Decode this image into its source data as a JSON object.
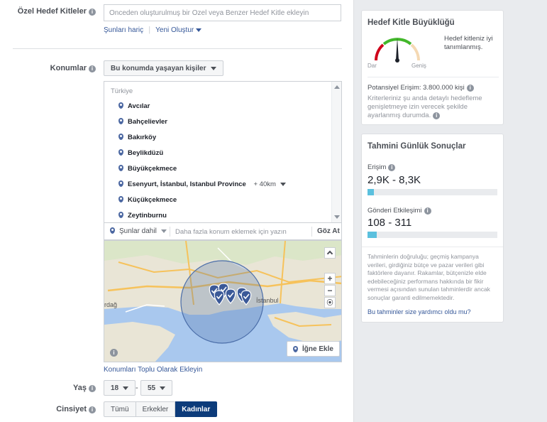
{
  "custom_audiences": {
    "label": "Özel Hedef Kitleler",
    "placeholder": "Onceden oluşturulmuş bir Ozel veya Benzer Hedef Kitle ekleyin",
    "exclude_link": "Şunları hariç",
    "create_link": "Yeni Oluştur"
  },
  "locations": {
    "label": "Konumlar",
    "type_dropdown": "Bu konumda yaşayan kişiler",
    "country": "Türkiye",
    "items": [
      {
        "name": "Avcılar"
      },
      {
        "name": "Bahçelievler"
      },
      {
        "name": "Bakırköy"
      },
      {
        "name": "Beylikdüzü"
      },
      {
        "name": "Büyükçekmece"
      },
      {
        "name": "Esenyurt, İstanbul, Istanbul Province",
        "radius": "+ 40km"
      },
      {
        "name": "Küçükçekmece"
      },
      {
        "name": "Zeytinburnu"
      }
    ],
    "include_dropdown": "Şunlar dahil",
    "search_placeholder": "Daha fazla konum eklemek için yazın",
    "browse_label": "Göz At",
    "add_pin_label": "İğne Ekle",
    "bulk_link": "Konumları Toplu Olarak Ekleyin",
    "map": {
      "city_label": "İstanbul",
      "left_label": "rdağ",
      "zoom_in": "+",
      "zoom_out": "−",
      "pins": 6
    }
  },
  "age": {
    "label": "Yaş",
    "min": "18",
    "separator": "-",
    "max": "55"
  },
  "gender": {
    "label": "Cinsiyet",
    "options": [
      "Tümü",
      "Erkekler",
      "Kadınlar"
    ],
    "selected": "Kadınlar"
  },
  "audience_size": {
    "title": "Hedef Kitle Büyüklüğü",
    "status": "Hedef kitleniz iyi tanımlanmış.",
    "gauge_left": "Dar",
    "gauge_right": "Geniş",
    "potential_reach": "Potansiyel Erişim: 3.800.000 kişi",
    "criteria_note": "Kriterleriniz şu anda detaylı hedefleme genişletmeye izin verecek şekilde ayarlanmış durumda."
  },
  "daily_results": {
    "title": "Tahmini Günlük Sonuçlar",
    "reach_label": "Erişim",
    "reach_value": "2,9K - 8,3K",
    "reach_fill": 0.05,
    "engagement_label": "Gönderi Etkileşimi",
    "engagement_value": "108 - 311",
    "engagement_fill": 0.07,
    "disclaimer": "Tahminlerin doğruluğu; geçmiş kampanya verileri, girdiğiniz bütçe ve pazar verileri gibi faktörlere dayanır. Rakamlar, bütçenizle elde edebileceğiniz performans hakkında bir fikir vermesi açısından sunulan tahminlerdir ancak sonuçlar garanti edilmemektedir.",
    "help_link": "Bu tahminler size yardımcı oldu mu?"
  },
  "colors": {
    "accent": "#4267b2",
    "selected_gender_bg": "#0c3b7a",
    "bar_fill": "#5bc0de",
    "gauge_green": "#42b72a",
    "gauge_red": "#d0021b"
  }
}
